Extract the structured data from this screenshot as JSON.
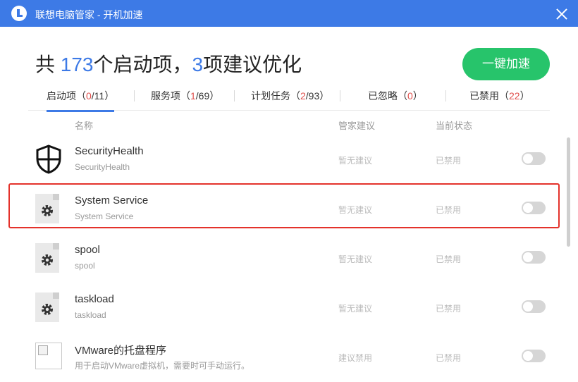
{
  "window": {
    "title": "联想电脑管家 - 开机加速"
  },
  "headline": {
    "prefix": "共 ",
    "startup_count": "173",
    "middle": "个启动项，",
    "suggest_count": "3",
    "suffix": "项建议优化"
  },
  "boost_button": {
    "label": "一键加速"
  },
  "tabs": [
    {
      "label": "启动项（",
      "highlight": "0",
      "rest": "/11）"
    },
    {
      "label": "服务项（",
      "highlight": "1",
      "rest": "/69）"
    },
    {
      "label": "计划任务（",
      "highlight": "2",
      "rest": "/93）"
    },
    {
      "label": "已忽略（",
      "highlight": "0",
      "rest": "）"
    },
    {
      "label": "已禁用（",
      "highlight": "22",
      "rest": "）"
    }
  ],
  "columns": {
    "name": "名称",
    "suggestion": "管家建议",
    "state": "当前状态"
  },
  "items": [
    {
      "title": "SecurityHealth",
      "subtitle": "SecurityHealth",
      "suggestion": "暂无建议",
      "state": "已禁用",
      "icon": "shield-icon",
      "enabled": false
    },
    {
      "title": "System Service",
      "subtitle": "System Service",
      "suggestion": "暂无建议",
      "state": "已禁用",
      "icon": "gear-file-icon",
      "enabled": false
    },
    {
      "title": "spool",
      "subtitle": "spool",
      "suggestion": "暂无建议",
      "state": "已禁用",
      "icon": "gear-file-icon",
      "enabled": false
    },
    {
      "title": "taskload",
      "subtitle": "taskload",
      "suggestion": "暂无建议",
      "state": "已禁用",
      "icon": "gear-file-icon",
      "enabled": false
    },
    {
      "title": "VMware的托盘程序",
      "subtitle": "用于启动VMware虚拟机，需要时可手动运行。",
      "suggestion": "建议禁用",
      "state": "已禁用",
      "icon": "broken-image-icon",
      "enabled": false
    }
  ],
  "colors": {
    "accent": "#3d7ae6",
    "boost": "#27c46b",
    "highlight_count": "#e0504d",
    "selection_border": "#e4322b"
  }
}
